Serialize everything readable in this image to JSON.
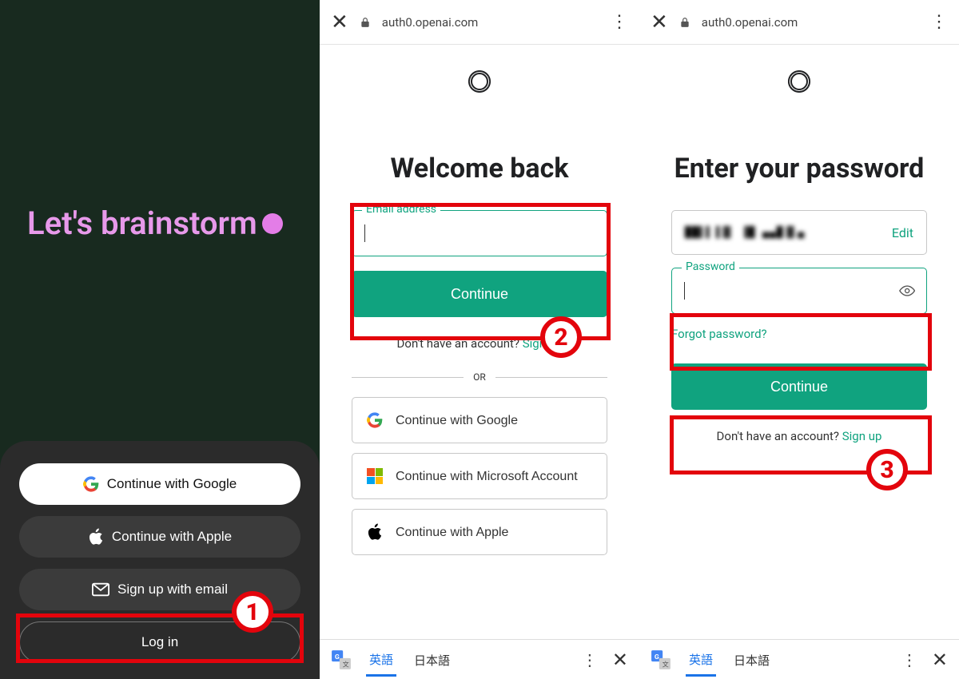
{
  "panel1": {
    "tagline": "Let's brainstorm",
    "buttons": {
      "google": "Continue with Google",
      "apple": "Continue with Apple",
      "email": "Sign up with email",
      "login": "Log in"
    }
  },
  "panel2": {
    "url": "auth0.openai.com",
    "heading": "Welcome back",
    "email_label": "Email address",
    "continue": "Continue",
    "no_account": "Don't have an account?",
    "signup": "Sign up",
    "or": "OR",
    "social": {
      "google": "Continue with Google",
      "microsoft": "Continue with Microsoft Account",
      "apple": "Continue with Apple"
    },
    "translate": {
      "active": "英語",
      "inactive": "日本語"
    }
  },
  "panel3": {
    "url": "auth0.openai.com",
    "heading": "Enter your password",
    "email_masked": "██▌▌▐▐▌ ▐█ ▄▄█▐▌▄",
    "edit": "Edit",
    "password_label": "Password",
    "continue": "Continue",
    "forgot": "Forgot password?",
    "no_account": "Don't have an account?",
    "signup": "Sign up",
    "translate": {
      "active": "英語",
      "inactive": "日本語"
    }
  },
  "steps": {
    "s1": "1",
    "s2": "2",
    "s3": "3"
  }
}
